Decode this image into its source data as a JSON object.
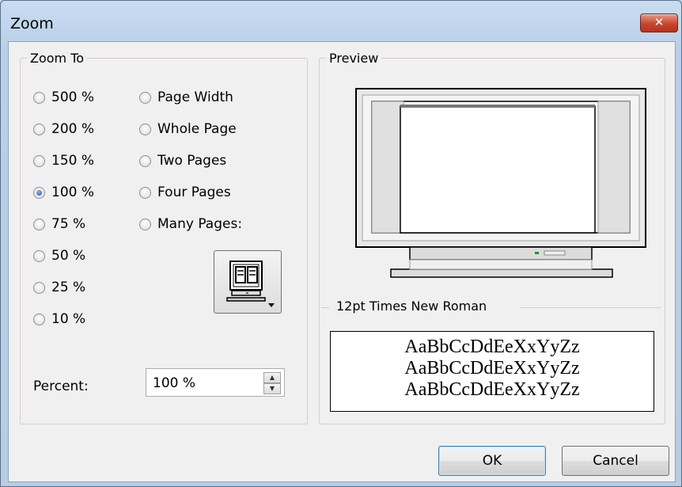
{
  "window": {
    "title": "Zoom",
    "close_symbol": "✕"
  },
  "zoom_to": {
    "legend": "Zoom To",
    "percent_options": [
      "500 %",
      "200 %",
      "150 %",
      "100 %",
      "75 %",
      "50 %",
      "25 %",
      "10 %"
    ],
    "page_options": [
      "Page Width",
      "Whole Page",
      "Two Pages",
      "Four Pages",
      "Many Pages:"
    ],
    "selected": "100 %",
    "percent_label": "Percent:",
    "percent_value": "100 %"
  },
  "preview": {
    "legend": "Preview",
    "font_label": "12pt Times New Roman",
    "sample_lines": [
      "AaBbCcDdEeXxYyZz",
      "AaBbCcDdEeXxYyZz",
      "AaBbCcDdEeXxYyZz"
    ]
  },
  "buttons": {
    "ok": "OK",
    "cancel": "Cancel"
  }
}
